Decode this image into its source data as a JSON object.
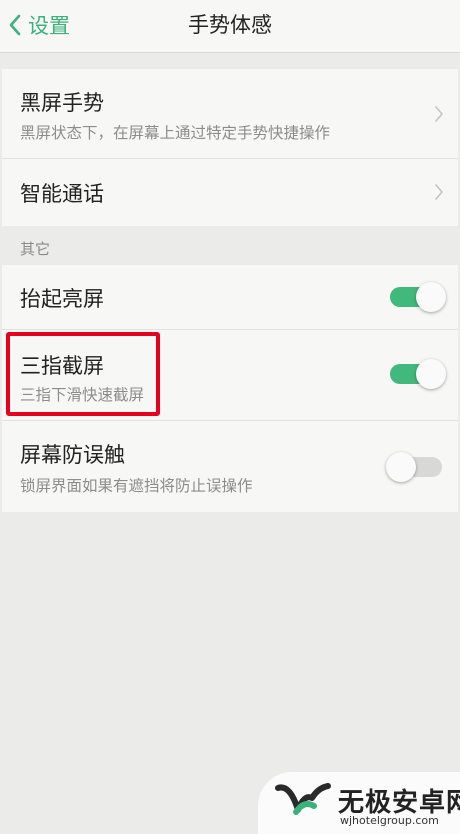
{
  "header": {
    "back_label": "设置",
    "title": "手势体感"
  },
  "colors": {
    "accent": "#3bb27c",
    "toggle_on": "#41b87c",
    "toggle_off": "#d8d8d6",
    "highlight": "#e6001e"
  },
  "group1": {
    "items": [
      {
        "title": "黑屏手势",
        "subtitle": "黑屏状态下，在屏幕上通过特定手势快捷操作",
        "icon": "chevron-right-icon"
      },
      {
        "title": "智能通话",
        "icon": "chevron-right-icon"
      }
    ]
  },
  "section2": {
    "label": "其它"
  },
  "group2": {
    "items": [
      {
        "title": "抬起亮屏",
        "toggle": "on"
      },
      {
        "title": "三指截屏",
        "subtitle": "三指下滑快速截屏",
        "toggle": "on"
      },
      {
        "title": "屏幕防误触",
        "subtitle": "锁屏界面如果有遮挡将防止误操作",
        "toggle": "off"
      }
    ]
  },
  "watermark": {
    "name": "无极安卓网",
    "url": "wjhotelgroup.com"
  }
}
